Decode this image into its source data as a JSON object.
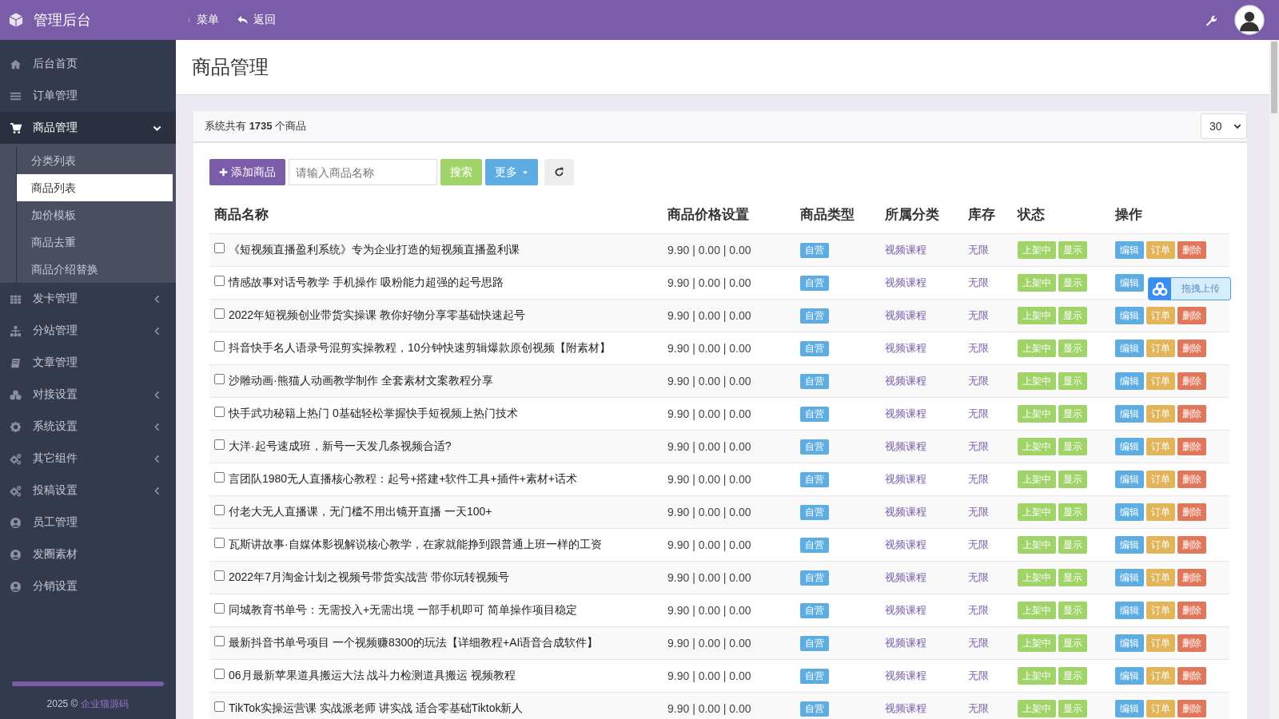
{
  "topbar": {
    "title": "管理后台",
    "menu": "菜单",
    "back": "返回"
  },
  "sidebar": {
    "items": [
      {
        "label": "后台首页",
        "kind": "link",
        "selected": false
      },
      {
        "label": "订单管理",
        "kind": "link",
        "selected": false
      },
      {
        "label": "商品管理",
        "kind": "group",
        "expanded": true,
        "selected": true,
        "children": [
          {
            "label": "分类列表",
            "selected": false
          },
          {
            "label": "商品列表",
            "selected": true
          },
          {
            "label": "加价模板",
            "selected": false
          },
          {
            "label": "商品去重",
            "selected": false
          },
          {
            "label": "商品介绍替换",
            "selected": false
          }
        ]
      },
      {
        "label": "发卡管理",
        "kind": "group",
        "expanded": false,
        "selected": false
      },
      {
        "label": "分站管理",
        "kind": "group",
        "expanded": false,
        "selected": false
      },
      {
        "label": "文章管理",
        "kind": "link",
        "selected": false
      },
      {
        "label": "对接设置",
        "kind": "group",
        "expanded": false,
        "selected": false
      },
      {
        "label": "系统设置",
        "kind": "group",
        "expanded": false,
        "selected": false
      },
      {
        "label": "其它组件",
        "kind": "group",
        "expanded": false,
        "selected": false
      },
      {
        "label": "投稿设置",
        "kind": "group",
        "expanded": false,
        "selected": false
      },
      {
        "label": "员工管理",
        "kind": "link",
        "selected": false
      },
      {
        "label": "发圈素材",
        "kind": "link",
        "selected": false
      },
      {
        "label": "分销设置",
        "kind": "link",
        "selected": false
      }
    ],
    "footer": {
      "year": "2025 ©",
      "link": "企业猫源码"
    }
  },
  "page_title": "商品管理",
  "summary": "系统共有 **1735** 个商品",
  "page_size": "30",
  "toolbar": {
    "add": "添加商品",
    "search_placeholder": "请输入商品名称",
    "search": "搜索",
    "more": "更多"
  },
  "table": {
    "columns": [
      "商品名称",
      "商品价格设置",
      "商品类型",
      "所属分类",
      "库存",
      "状态",
      "操作"
    ],
    "rows": [
      {
        "checked": false,
        "name": "《短视频直播盈利系统》专为企业打造的短视频直播盈利课",
        "price": "9.90 | 0.00 | 0.00",
        "type": "自营",
        "category": "视频课程",
        "stock": "无限",
        "status": [
          "上架中",
          "显示"
        ],
        "actions": [
          "编辑",
          "订单",
          "删除"
        ]
      },
      {
        "checked": false,
        "name": "情感故事对话号教学 手机操作 吸粉能力超强的起号思路",
        "price": "9.90 | 0.00 | 0.00",
        "type": "自营",
        "category": "视频课程",
        "stock": "无限",
        "status": [
          "上架中",
          "显示"
        ],
        "actions": [
          "编辑"
        ]
      },
      {
        "checked": false,
        "name": "2022年短视频创业带货实操课 教你好物分享零基础快速起号",
        "price": "9.90 | 0.00 | 0.00",
        "type": "自营",
        "category": "视频课程",
        "stock": "无限",
        "status": [
          "上架中",
          "显示"
        ],
        "actions": [
          "编辑",
          "订单",
          "删除"
        ]
      },
      {
        "checked": false,
        "name": "抖音快手名人语录号混剪实操教程，10分钟快速剪辑爆款原创视频【附素材】",
        "price": "9.90 | 0.00 | 0.00",
        "type": "自营",
        "category": "视频课程",
        "stock": "无限",
        "status": [
          "上架中",
          "显示"
        ],
        "actions": [
          "编辑",
          "订单",
          "删除"
        ]
      },
      {
        "checked": false,
        "name": "沙雕动画·熊猫人动画教学制作 全套素材文案教程分享",
        "price": "9.90 | 0.00 | 0.00",
        "type": "自营",
        "category": "视频课程",
        "stock": "无限",
        "status": [
          "上架中",
          "显示"
        ],
        "actions": [
          "编辑",
          "订单",
          "删除"
        ]
      },
      {
        "checked": false,
        "name": "快手武功秘籍上热门 0基础轻松掌握快手短视频上热门技术",
        "price": "9.90 | 0.00 | 0.00",
        "type": "自营",
        "category": "视频课程",
        "stock": "无限",
        "status": [
          "上架中",
          "显示"
        ],
        "actions": [
          "编辑",
          "订单",
          "删除"
        ]
      },
      {
        "checked": false,
        "name": "大洋·起号速成班，新号一天发几条视频合适?",
        "price": "9.90 | 0.00 | 0.00",
        "type": "自营",
        "category": "视频课程",
        "stock": "无限",
        "status": [
          "上架中",
          "显示"
        ],
        "actions": [
          "编辑",
          "订单",
          "删除"
        ]
      },
      {
        "checked": false,
        "name": "言团队1980无人直播核心教程：起号+搭建+软件工具+插件+素材+话术",
        "price": "9.90 | 0.00 | 0.00",
        "type": "自营",
        "category": "视频课程",
        "stock": "无限",
        "status": [
          "上架中",
          "显示"
        ],
        "actions": [
          "编辑",
          "订单",
          "删除"
        ]
      },
      {
        "checked": false,
        "name": "付老大无人直播课，无门槛不用出镜开直播 一天100+",
        "price": "9.90 | 0.00 | 0.00",
        "type": "自营",
        "category": "视频课程",
        "stock": "无限",
        "status": [
          "上架中",
          "显示"
        ],
        "actions": [
          "编辑",
          "订单",
          "删除"
        ]
      },
      {
        "checked": false,
        "name": "瓦斯讲故事·自媒体影视解说核心教学，在家就能挣到跟普通上班一样的工资",
        "price": "9.90 | 0.00 | 0.00",
        "type": "自营",
        "category": "视频课程",
        "stock": "无限",
        "status": [
          "上架中",
          "显示"
        ],
        "actions": [
          "编辑",
          "订单",
          "删除"
        ]
      },
      {
        "checked": false,
        "name": "2022年7月淘金计划之视频号带货实战营 带你玩转视频号",
        "price": "9.90 | 0.00 | 0.00",
        "type": "自营",
        "category": "视频课程",
        "stock": "无限",
        "status": [
          "上架中",
          "显示"
        ],
        "actions": [
          "编辑",
          "订单",
          "删除"
        ]
      },
      {
        "checked": false,
        "name": "同城教育书单号：无需投入+无需出境 一部手机即可 简单操作项目稳定",
        "price": "9.90 | 0.00 | 0.00",
        "type": "自营",
        "category": "视频课程",
        "stock": "无限",
        "status": [
          "上架中",
          "显示"
        ],
        "actions": [
          "编辑",
          "订单",
          "删除"
        ]
      },
      {
        "checked": false,
        "name": "最新抖音书单号项目 一个视频赚8300的玩法【详细教程+AI语音合成软件】",
        "price": "9.90 | 0.00 | 0.00",
        "type": "自营",
        "category": "视频课程",
        "stock": "无限",
        "status": [
          "上架中",
          "显示"
        ],
        "actions": [
          "编辑",
          "订单",
          "删除"
        ]
      },
      {
        "checked": false,
        "name": "06月最新苹果道具搬运大法 战斗力检测道具搬运 视频教程",
        "price": "9.90 | 0.00 | 0.00",
        "type": "自营",
        "category": "视频课程",
        "stock": "无限",
        "status": [
          "上架中",
          "显示"
        ],
        "actions": [
          "编辑",
          "订单",
          "删除"
        ]
      },
      {
        "checked": false,
        "name": "TikTok实操运营课 实战派老师 讲实战 适合零基础Tiktok新人",
        "price": "9.90 | 0.00 | 0.00",
        "type": "自营",
        "category": "视频课程",
        "stock": "无限",
        "status": [
          "上架中",
          "显示"
        ],
        "actions": [
          "编辑",
          "订单",
          "删除"
        ]
      }
    ]
  },
  "upload_widget": {
    "label": "拖拽上传"
  }
}
